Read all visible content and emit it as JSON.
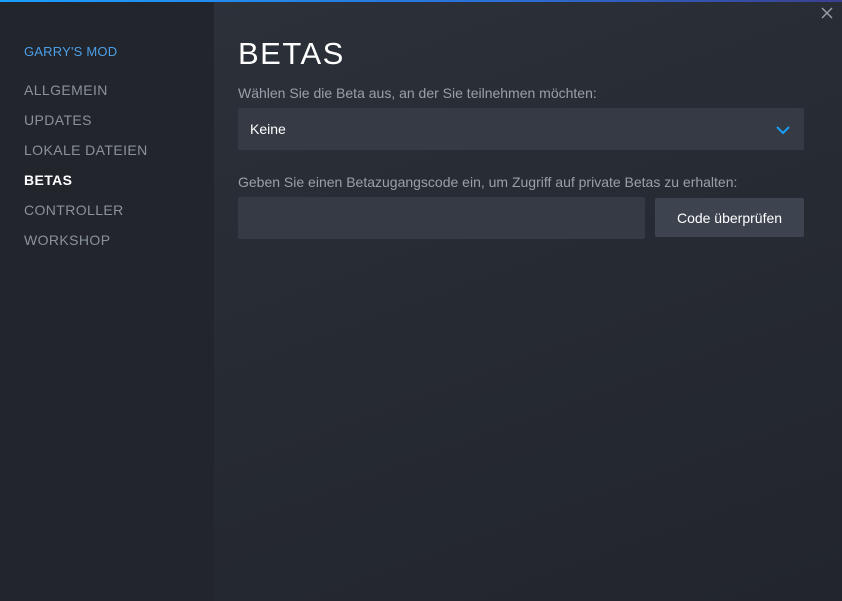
{
  "colors": {
    "accent": "#1a9fff",
    "game_title": "#4b9fe8",
    "field_bg": "#353a44",
    "button_bg": "#3d4450"
  },
  "icons": {
    "close": "close-icon",
    "dropdown": "chevron-down-icon"
  },
  "sidebar": {
    "game_title": "GARRY'S MOD",
    "items": [
      {
        "label": "ALLGEMEIN",
        "active": false
      },
      {
        "label": "UPDATES",
        "active": false
      },
      {
        "label": "LOKALE DATEIEN",
        "active": false
      },
      {
        "label": "BETAS",
        "active": true
      },
      {
        "label": "CONTROLLER",
        "active": false
      },
      {
        "label": "WORKSHOP",
        "active": false
      }
    ]
  },
  "main": {
    "title": "BETAS",
    "beta_select": {
      "label": "Wählen Sie die Beta aus, an der Sie teilnehmen möchten:",
      "selected": "Keine"
    },
    "access_code": {
      "label": "Geben Sie einen Betazugangscode ein, um Zugriff auf private Betas zu erhalten:",
      "value": "",
      "button_label": "Code überprüfen"
    }
  }
}
